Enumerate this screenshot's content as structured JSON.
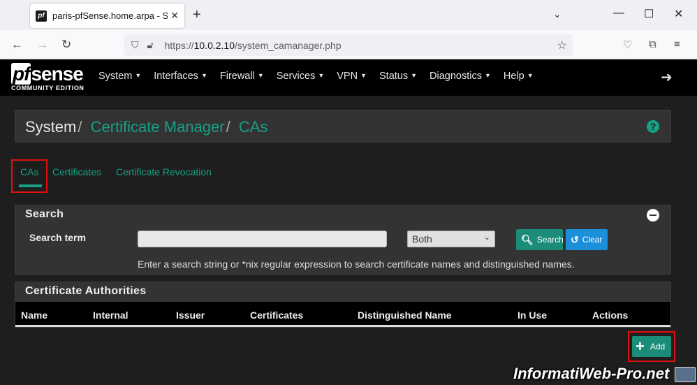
{
  "browser": {
    "tab_title": "paris-pfSense.home.arpa - Syste",
    "tab_favicon": "pf",
    "url_prefix": "https://",
    "url_host": "10.0.2.10",
    "url_path": "/system_camanager.php"
  },
  "header": {
    "logo_main": "sense",
    "logo_pf": "pf",
    "logo_sub": "COMMUNITY EDITION",
    "menu": [
      "System",
      "Interfaces",
      "Firewall",
      "Services",
      "VPN",
      "Status",
      "Diagnostics",
      "Help"
    ]
  },
  "breadcrumb": {
    "root": "System",
    "section": "Certificate Manager",
    "page": "CAs"
  },
  "tabs": [
    "CAs",
    "Certificates",
    "Certificate Revocation"
  ],
  "search": {
    "title": "Search",
    "term_label": "Search term",
    "term_value": "",
    "scope_selected": "Both",
    "search_button": "Search",
    "clear_button": "Clear",
    "help_text": "Enter a search string or *nix regular expression to search certificate names and distinguished names."
  },
  "ca_panel": {
    "title": "Certificate Authorities",
    "columns": [
      "Name",
      "Internal",
      "Issuer",
      "Certificates",
      "Distinguished Name",
      "In Use",
      "Actions"
    ]
  },
  "add_button": "Add",
  "watermark": "InformatiWeb-Pro.net",
  "colors": {
    "accent": "#16a085",
    "header_bg": "#000000",
    "page_bg": "#1e1e1e",
    "highlight": "#e01010",
    "clear_button": "#1b8fd9"
  }
}
